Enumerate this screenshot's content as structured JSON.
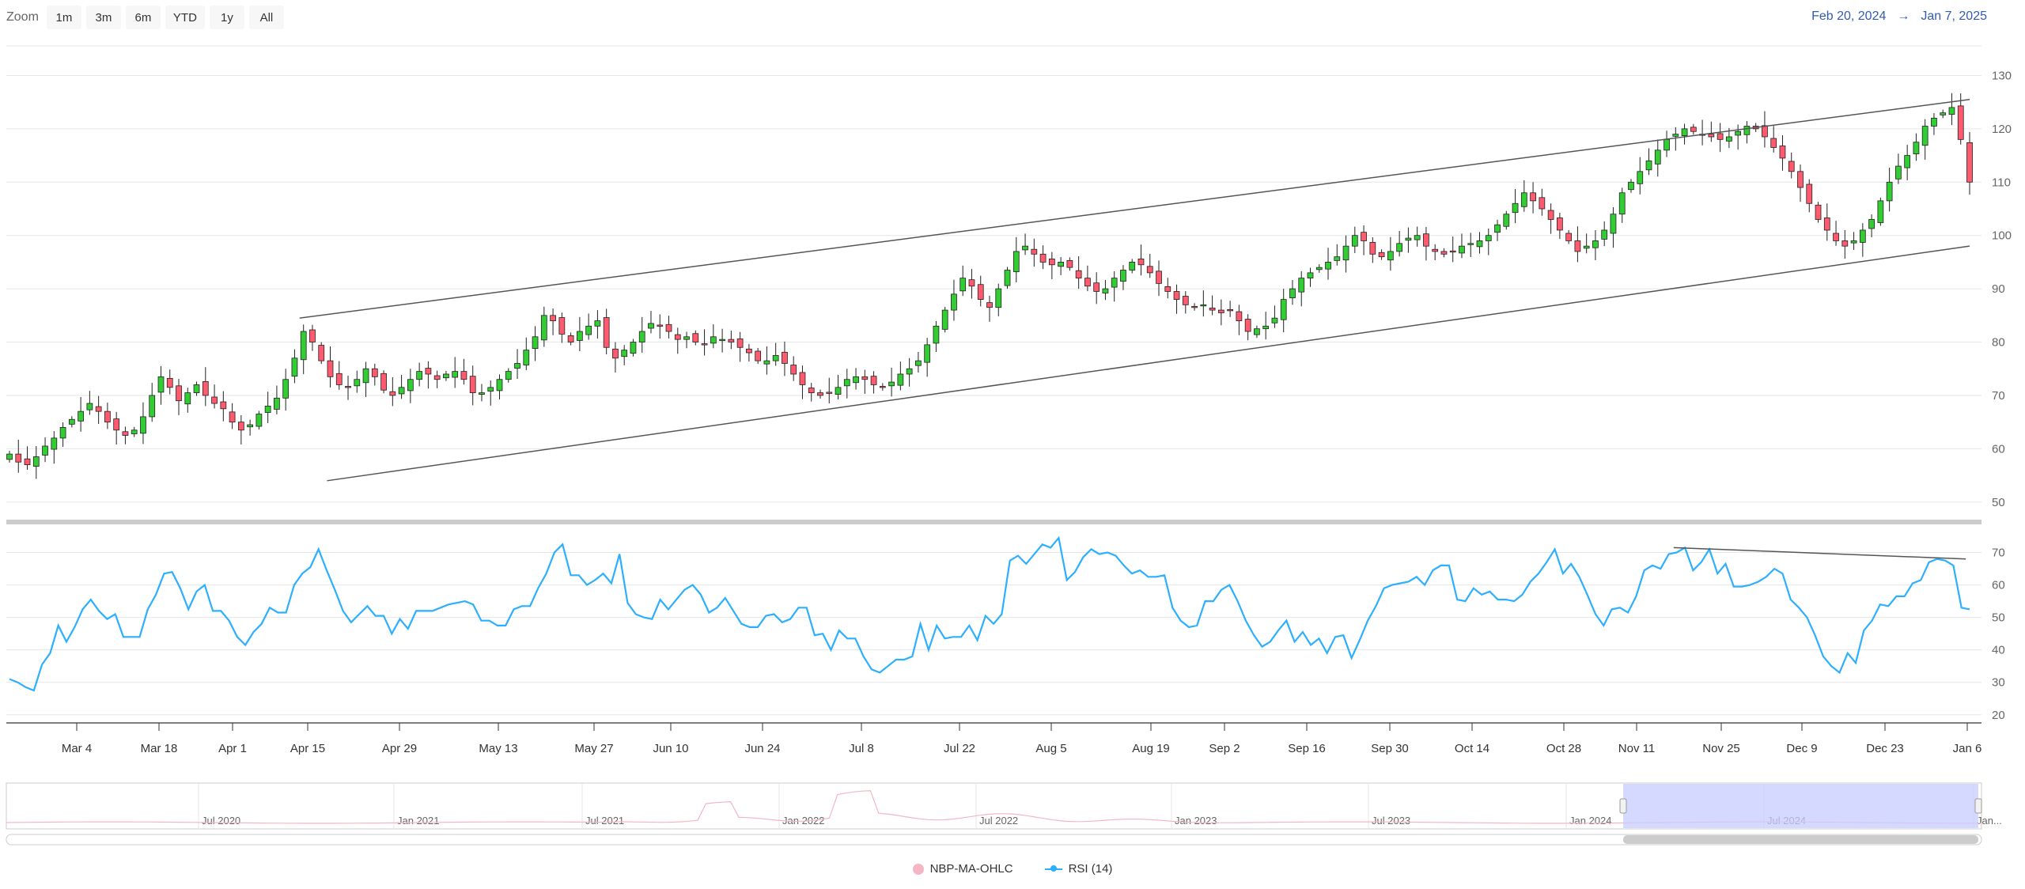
{
  "zoom": {
    "label": "Zoom",
    "buttons": [
      "1m",
      "3m",
      "6m",
      "YTD",
      "1y",
      "All"
    ]
  },
  "range": {
    "from": "Feb 20, 2024",
    "arrow": "→",
    "to": "Jan 7, 2025"
  },
  "legend": [
    {
      "name": "NBP-MA-OHLC",
      "color": "#f4b6c2"
    },
    {
      "name": "RSI (14)",
      "color": "#2caffe"
    }
  ],
  "colors": {
    "up": "#32cd32",
    "down": "#ff5a6e",
    "rsi": "#2caffe",
    "navigator_fill": "#c8ccff",
    "navigator_series": "#f4b6c2"
  },
  "navigator": {
    "labels": [
      "Jul 2020",
      "Jan 2021",
      "Jul 2021",
      "Jan 2022",
      "Jul 2022",
      "Jan 2023",
      "Jul 2023",
      "Jan 2024",
      "Jul 2024",
      "Jan..."
    ]
  },
  "chart_data": {
    "type": "candlestick",
    "x_ticks": [
      "Mar 4",
      "Mar 18",
      "Apr 1",
      "Apr 15",
      "Apr 29",
      "May 13",
      "May 27",
      "Jun 10",
      "Jun 24",
      "Jul 8",
      "Jul 22",
      "Aug 5",
      "Aug 19",
      "Sep 2",
      "Sep 16",
      "Sep 30",
      "Oct 14",
      "Oct 28",
      "Nov 11",
      "Nov 25",
      "Dec 9",
      "Dec 23",
      "Jan 6"
    ],
    "price_axis": {
      "ticks": [
        50,
        60,
        70,
        80,
        90,
        100,
        110,
        120,
        130
      ],
      "ylim": [
        47,
        136
      ]
    },
    "rsi_axis": {
      "ticks": [
        20,
        30,
        40,
        50,
        60,
        70
      ],
      "ylim": [
        18,
        75
      ]
    },
    "price_close": [
      59,
      57.5,
      57,
      58.5,
      60.5,
      62,
      64,
      65.5,
      67,
      68.5,
      67,
      65,
      63.5,
      62.5,
      63.5,
      66,
      70,
      73.5,
      71.5,
      69,
      70.5,
      72,
      70,
      68.5,
      67.5,
      65,
      63.5,
      64.5,
      66.5,
      68,
      69.5,
      73,
      77,
      82,
      80,
      76.5,
      73.5,
      72,
      71.5,
      73,
      75,
      73.5,
      71,
      70,
      71.5,
      73,
      74.5,
      74,
      73,
      74,
      74.5,
      73,
      70.5,
      70.5,
      71.5,
      73,
      74.5,
      76,
      78.5,
      81,
      85,
      84,
      81.5,
      80,
      82,
      83,
      84,
      79,
      77,
      78.5,
      80,
      82,
      83.5,
      83,
      82,
      80.5,
      81,
      80,
      79.5,
      81,
      80.5,
      80,
      79,
      78,
      76.5,
      76.5,
      77.5,
      76,
      74,
      72,
      70.5,
      70,
      70.5,
      71.5,
      73,
      73.5,
      73,
      72,
      71.5,
      72.5,
      74,
      75,
      76.5,
      79.5,
      83,
      86,
      89,
      92,
      90.5,
      88,
      86.5,
      90,
      93.5,
      97,
      98,
      96.5,
      95,
      94.5,
      95,
      94,
      92,
      90.5,
      89.5,
      90,
      92,
      93.5,
      95,
      94.5,
      93,
      91,
      89.5,
      88,
      87,
      86.5,
      87,
      86,
      85.5,
      86,
      84,
      82,
      82.5,
      83,
      84.5,
      88,
      90,
      92,
      93,
      94,
      95,
      96,
      98,
      100,
      99,
      96.5,
      96,
      97,
      98.5,
      99.5,
      100,
      98,
      97,
      96.5,
      97,
      98,
      98.5,
      99,
      100,
      102,
      104,
      106,
      108,
      106.5,
      105,
      103,
      101,
      99,
      97,
      98,
      99,
      101,
      104,
      108,
      110,
      112,
      114,
      116,
      118,
      119,
      120,
      119.5,
      119,
      118.5,
      118,
      118.5,
      119.5,
      120.5,
      120,
      118.5,
      116.5,
      114.5,
      112,
      109,
      106,
      103,
      101,
      99,
      98,
      99,
      101,
      103,
      106.5,
      110,
      113,
      115,
      117.5,
      120.5,
      122,
      123,
      124,
      118,
      110
    ],
    "rsi": [
      31,
      30,
      28.5,
      27.5,
      35.5,
      39,
      47.5,
      42.5,
      47,
      52.5,
      55.5,
      52,
      49.5,
      51,
      44,
      44,
      44,
      52.5,
      57,
      63.5,
      64,
      59,
      52.5,
      58,
      60,
      52,
      52,
      49,
      44,
      41.5,
      45.5,
      48,
      53,
      51.5,
      51.5,
      60,
      63.5,
      65.5,
      71,
      64.5,
      58.5,
      52,
      48.5,
      51,
      53.5,
      50.5,
      50.5,
      45,
      49.5,
      46.5,
      52,
      52,
      52,
      53,
      54,
      54.5,
      55,
      54,
      49,
      49,
      47.5,
      47.5,
      52.5,
      53.5,
      53.5,
      59,
      63.5,
      70,
      72.5,
      63,
      63,
      60,
      61.5,
      63.5,
      60.5,
      69.5,
      54.5,
      51,
      50,
      49.5,
      55.5,
      52.5,
      55.5,
      58.5,
      60,
      57,
      51.5,
      53,
      56,
      52,
      48,
      47,
      47,
      50.5,
      51,
      48.5,
      49.5,
      53,
      53,
      44.5,
      45,
      40,
      46,
      43.5,
      43.5,
      38,
      34,
      33,
      35,
      37,
      37,
      38,
      48,
      40,
      47.5,
      43.5,
      44,
      44,
      47.5,
      43,
      50.5,
      48,
      51,
      67.5,
      69,
      66.5,
      69.5,
      72.5,
      71.5,
      74.5,
      61.5,
      64,
      68.5,
      71,
      69.5,
      70,
      69,
      66,
      63.5,
      64.5,
      62.5,
      62.5,
      63,
      53,
      49,
      47,
      47.5,
      55,
      55,
      58.5,
      60,
      55,
      49,
      44.5,
      41,
      42.5,
      46,
      49,
      42.5,
      45.5,
      41.5,
      43.5,
      39,
      44,
      44.5,
      37.5,
      43,
      49,
      53.5,
      59,
      60,
      60.5,
      61,
      62.5,
      60,
      64.5,
      66,
      66,
      55.5,
      55,
      59,
      57,
      58,
      55.5,
      55.5,
      55,
      57,
      61,
      63.5,
      67,
      71,
      63.5,
      66.5,
      62.5,
      57,
      51,
      47.5,
      52.5,
      53,
      51.5,
      56.5,
      64.5,
      66,
      65,
      69.5,
      70,
      71.5,
      64.5,
      67,
      71,
      63.5,
      66.5,
      59.5,
      59.5,
      60,
      61,
      62.5,
      65,
      63.5,
      55.5,
      53,
      50,
      44.5,
      38,
      35,
      33,
      39,
      36,
      46,
      49,
      54,
      53.5,
      56.5,
      56.5,
      60.5,
      61.5,
      67,
      68,
      67.5,
      66,
      53,
      52.5
    ],
    "trendlines": [
      {
        "panel": "price",
        "from": [
          0.148,
          84.5
        ],
        "to": [
          1.0,
          125.5
        ]
      },
      {
        "panel": "price",
        "from": [
          0.162,
          54
        ],
        "to": [
          1.0,
          98
        ]
      },
      {
        "panel": "rsi",
        "from": [
          0.849,
          71.5
        ],
        "to": [
          0.998,
          68
        ]
      }
    ]
  }
}
